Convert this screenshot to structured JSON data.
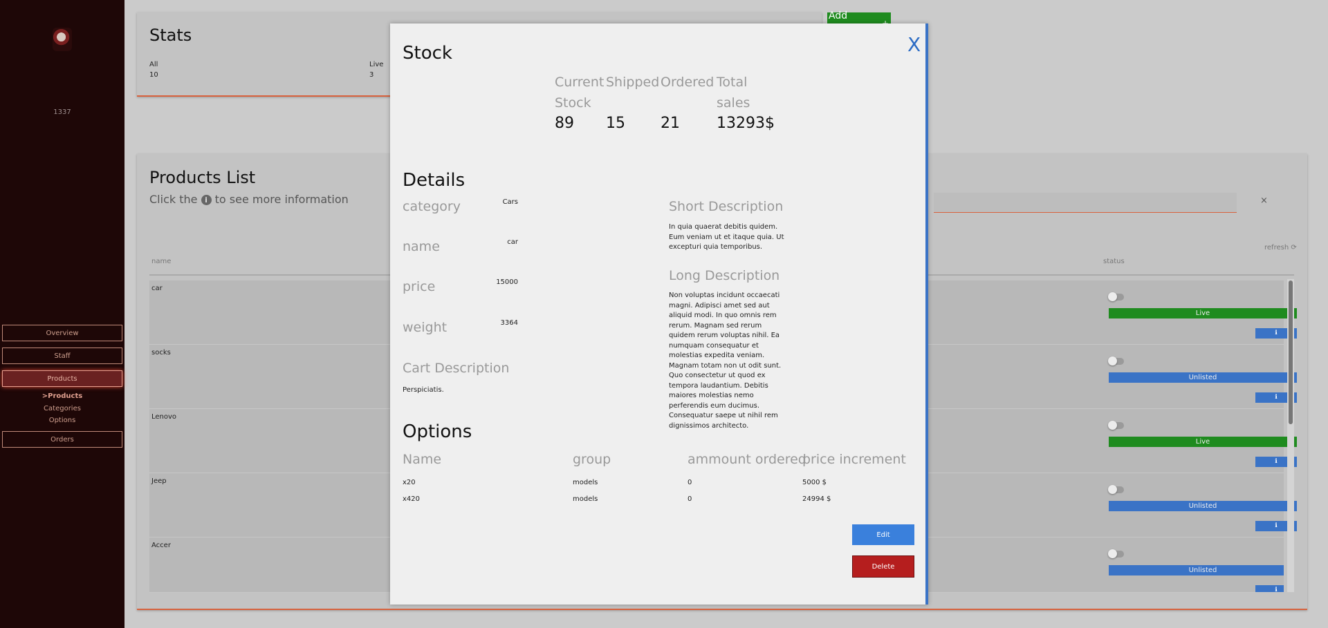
{
  "sidebar": {
    "user_id": "1337",
    "nav": {
      "overview": "Overview",
      "staff": "Staff",
      "products": "Products",
      "orders": "Orders"
    },
    "subnav": {
      "products": ">Products",
      "categories": "Categories",
      "options": "Options"
    }
  },
  "stats": {
    "title": "Stats",
    "all_label": "All",
    "all_value": "10",
    "live_label": "Live",
    "live_value": "3"
  },
  "add_button": {
    "label": "Add",
    "icon": "+"
  },
  "products": {
    "title": "Products List",
    "subtitle_before": "Click the",
    "subtitle_icon": "i",
    "subtitle_after": "to see more information",
    "search_clear": "×",
    "refresh_label": "refresh ⟳",
    "columns": {
      "name": "name",
      "status": "status"
    },
    "rows": [
      {
        "name": "car",
        "status": "Live",
        "status_type": "live"
      },
      {
        "name": "socks",
        "status": "Unlisted",
        "status_type": "unlisted"
      },
      {
        "name": "Lenovo",
        "status": "Live",
        "status_type": "live"
      },
      {
        "name": "Jeep",
        "status": "Unlisted",
        "status_type": "unlisted"
      },
      {
        "name": "Accer",
        "status": "Unlisted",
        "status_type": "unlisted"
      }
    ],
    "info_icon": "ℹ"
  },
  "modal": {
    "close": "X",
    "stock": {
      "title": "Stock",
      "headers": [
        "Current Stock",
        "Shipped",
        "Ordered",
        "Total sales"
      ],
      "values": [
        "89",
        "15",
        "21",
        "13293$"
      ]
    },
    "details": {
      "title": "Details",
      "fields": [
        {
          "label": "category",
          "value": "Cars"
        },
        {
          "label": "name",
          "value": "car"
        },
        {
          "label": "price",
          "value": "15000"
        },
        {
          "label": "weight",
          "value": "3364"
        }
      ],
      "cart_description_label": "Cart Description",
      "cart_description": "Perspiciatis.",
      "short_description_label": "Short Description",
      "short_description": "In quia quaerat debitis quidem. Eum veniam ut et itaque quia. Ut excepturi quia temporibus.",
      "long_description_label": "Long Description",
      "long_description": "Non voluptas incidunt occaecati magni. Adipisci amet sed aut aliquid modi. In quo omnis rem rerum. Magnam sed rerum quidem rerum voluptas nihil. Ea numquam consequatur et molestias expedita veniam. Magnam totam non ut odit sunt. Quo consectetur ut quod ex tempora laudantium. Debitis maiores molestias nemo perferendis eum ducimus. Consequatur saepe ut nihil rem dignissimos architecto."
    },
    "options": {
      "title": "Options",
      "headers": [
        "Name",
        "group",
        "ammount ordered",
        "price increment"
      ],
      "rows": [
        [
          "x20",
          "models",
          "0",
          "5000 $"
        ],
        [
          "x420",
          "models",
          "0",
          "24994 $"
        ]
      ]
    },
    "edit_label": "Edit",
    "delete_label": "Delete"
  }
}
